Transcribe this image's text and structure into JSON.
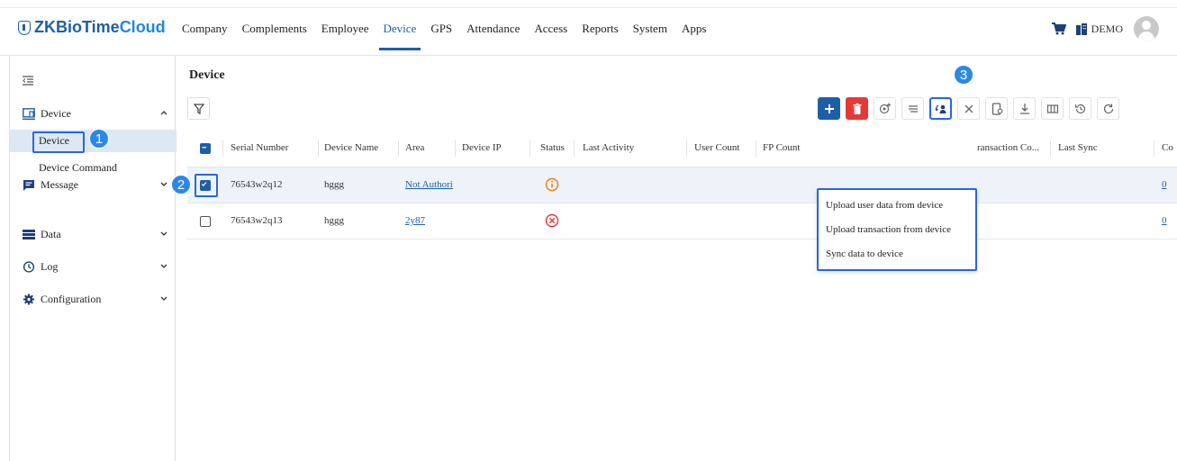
{
  "brand": {
    "part1": "ZKBioTime",
    "part2": "Cloud"
  },
  "nav": [
    "Company",
    "Complements",
    "Employee",
    "Device",
    "GPS",
    "Attendance",
    "Access",
    "Reports",
    "System",
    "Apps"
  ],
  "nav_active": "Device",
  "topright": {
    "org": "DEMO"
  },
  "sidebar": {
    "groups": [
      {
        "label": "Device",
        "icon": "device-icon",
        "expanded": true
      },
      {
        "label": "Message",
        "icon": "message-icon"
      },
      {
        "label": "Data",
        "icon": "data-icon"
      },
      {
        "label": "Log",
        "icon": "clock-icon"
      },
      {
        "label": "Configuration",
        "icon": "gear-icon"
      }
    ],
    "subitems": [
      "Device",
      "Device Command"
    ]
  },
  "page": {
    "title": "Device"
  },
  "table": {
    "columns": [
      "Serial Number",
      "Device Name",
      "Area",
      "Device IP",
      "Status",
      "Last Activity",
      "User Count",
      "FP Count",
      "ransaction Co...",
      "Last Sync",
      "Co"
    ],
    "rows": [
      {
        "serial": "76543w2q12",
        "name": "hggg",
        "area": "Not Authoriz",
        "status": "warning",
        "count": "0",
        "checked": true
      },
      {
        "serial": "76543w2q13",
        "name": "hggg",
        "area": "2y87",
        "status": "error",
        "count": "0",
        "checked": false
      }
    ]
  },
  "dropdown": [
    "Upload user data from device",
    "Upload transaction from device",
    "Sync data to device"
  ],
  "annotations": [
    "1",
    "2",
    "3"
  ],
  "colors": {
    "primary": "#1d5fa6",
    "danger": "#e53935",
    "warning": "#f57c00",
    "highlight": "#2966e0"
  }
}
